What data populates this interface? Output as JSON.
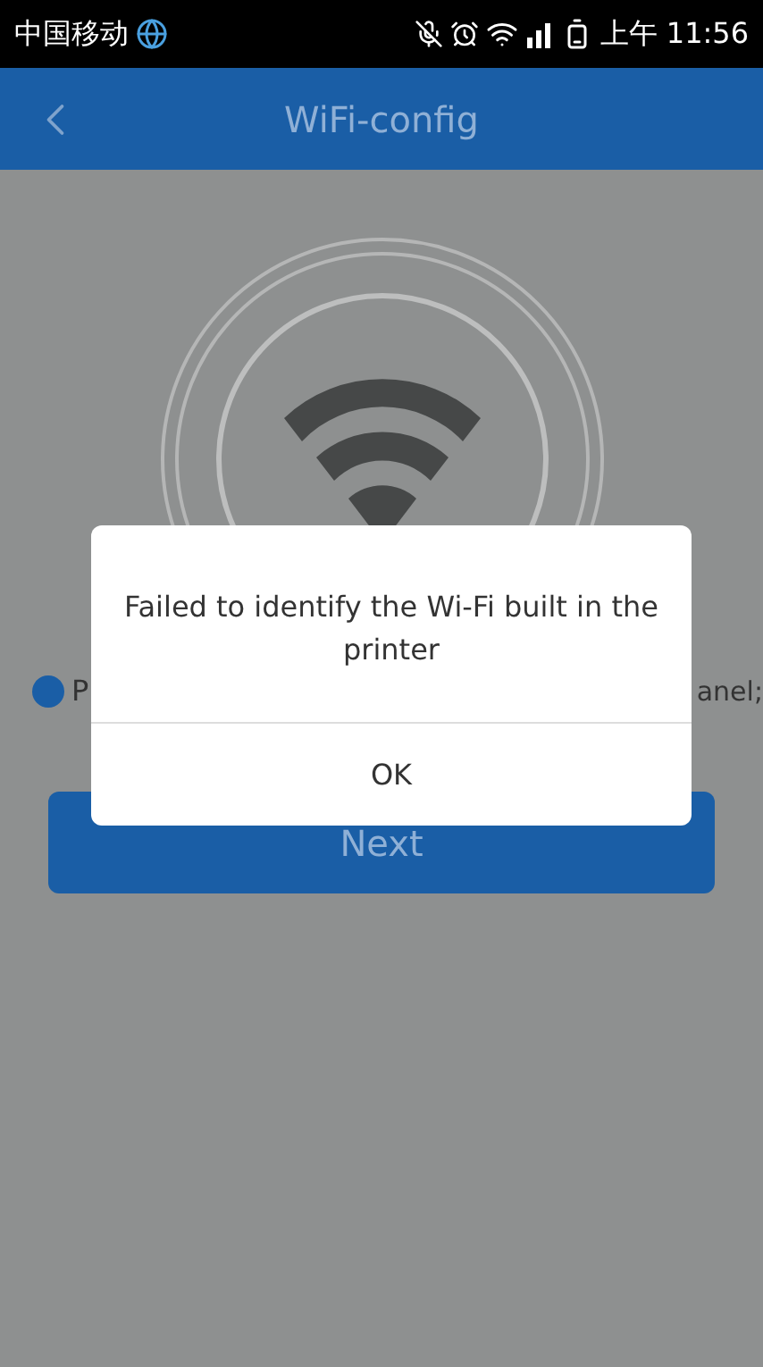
{
  "status_bar": {
    "carrier": "中国移动",
    "time": "上午 11:56"
  },
  "header": {
    "title": "WiFi-config"
  },
  "instruction": {
    "start": "P",
    "end": "anel;"
  },
  "next_button": {
    "label": "Next"
  },
  "dialog": {
    "message": "Failed to identify the Wi-Fi built in the printer",
    "button": "OK"
  }
}
